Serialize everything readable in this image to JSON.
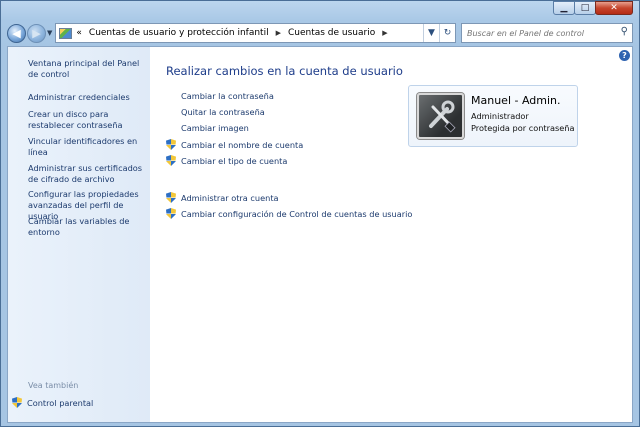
{
  "window": {
    "minimize_glyph": "▁",
    "maximize_glyph": "□",
    "close_glyph": "✕"
  },
  "nav": {
    "back_glyph": "◀",
    "forward_glyph": "▶",
    "dropdown_glyph": "▼",
    "overflow_glyph": "«",
    "breadcrumbs": [
      "Cuentas de usuario y protección infantil",
      "Cuentas de usuario"
    ],
    "crumb_separator": "▶",
    "address_dropdown_glyph": "▼",
    "refresh_glyph": "↻",
    "search_placeholder": "Buscar en el Panel de control",
    "search_icon": "search-icon"
  },
  "sidebar": {
    "items": [
      "Ventana principal del Panel de control",
      "Administrar credenciales",
      "Crear un disco para restablecer contraseña",
      "Vincular identificadores en línea",
      "Administrar sus certificados de cifrado de archivo",
      "Configurar las propiedades avanzadas del perfil de usuario",
      "Cambiar las variables de entorno"
    ],
    "see_also_label": "Vea también",
    "parental_control": "Control parental"
  },
  "main": {
    "title": "Realizar cambios en la cuenta de usuario",
    "help_glyph": "?",
    "tasks": [
      {
        "label": "Cambiar la contraseña",
        "shield": false
      },
      {
        "label": "Quitar la contraseña",
        "shield": false
      },
      {
        "label": "Cambiar imagen",
        "shield": false
      },
      {
        "label": "Cambiar el nombre de cuenta",
        "shield": true
      },
      {
        "label": "Cambiar el tipo de cuenta",
        "shield": true
      }
    ],
    "other_tasks": [
      {
        "label": "Administrar otra cuenta",
        "shield": true
      },
      {
        "label": "Cambiar configuración de Control de cuentas de usuario",
        "shield": true
      }
    ]
  },
  "account": {
    "name": "Manuel - Admin.",
    "type": "Administrador",
    "status": "Protegida por contraseña"
  },
  "colors": {
    "link": "#1d3b6e",
    "title": "#1e3d8a",
    "shield_blue": "#2d6fc4",
    "shield_yellow": "#f2c73a"
  }
}
